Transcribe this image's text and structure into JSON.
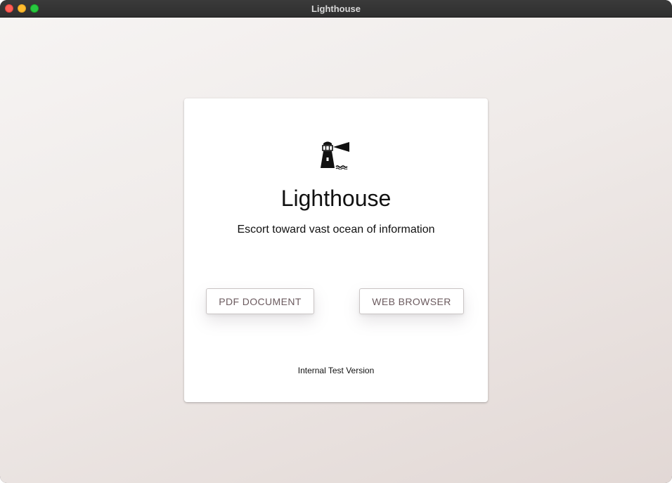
{
  "window": {
    "title": "Lighthouse"
  },
  "card": {
    "logo_icon": "lighthouse-icon",
    "title": "Lighthouse",
    "tagline": "Escort toward vast ocean of information",
    "buttons": {
      "pdf_label": "PDF DOCUMENT",
      "web_label": "WEB BROWSER"
    },
    "version": "Internal Test Version"
  },
  "colors": {
    "button_text": "#6b5a5e",
    "close": "#ff5f57",
    "minimize": "#febc2e",
    "maximize": "#28c840"
  }
}
